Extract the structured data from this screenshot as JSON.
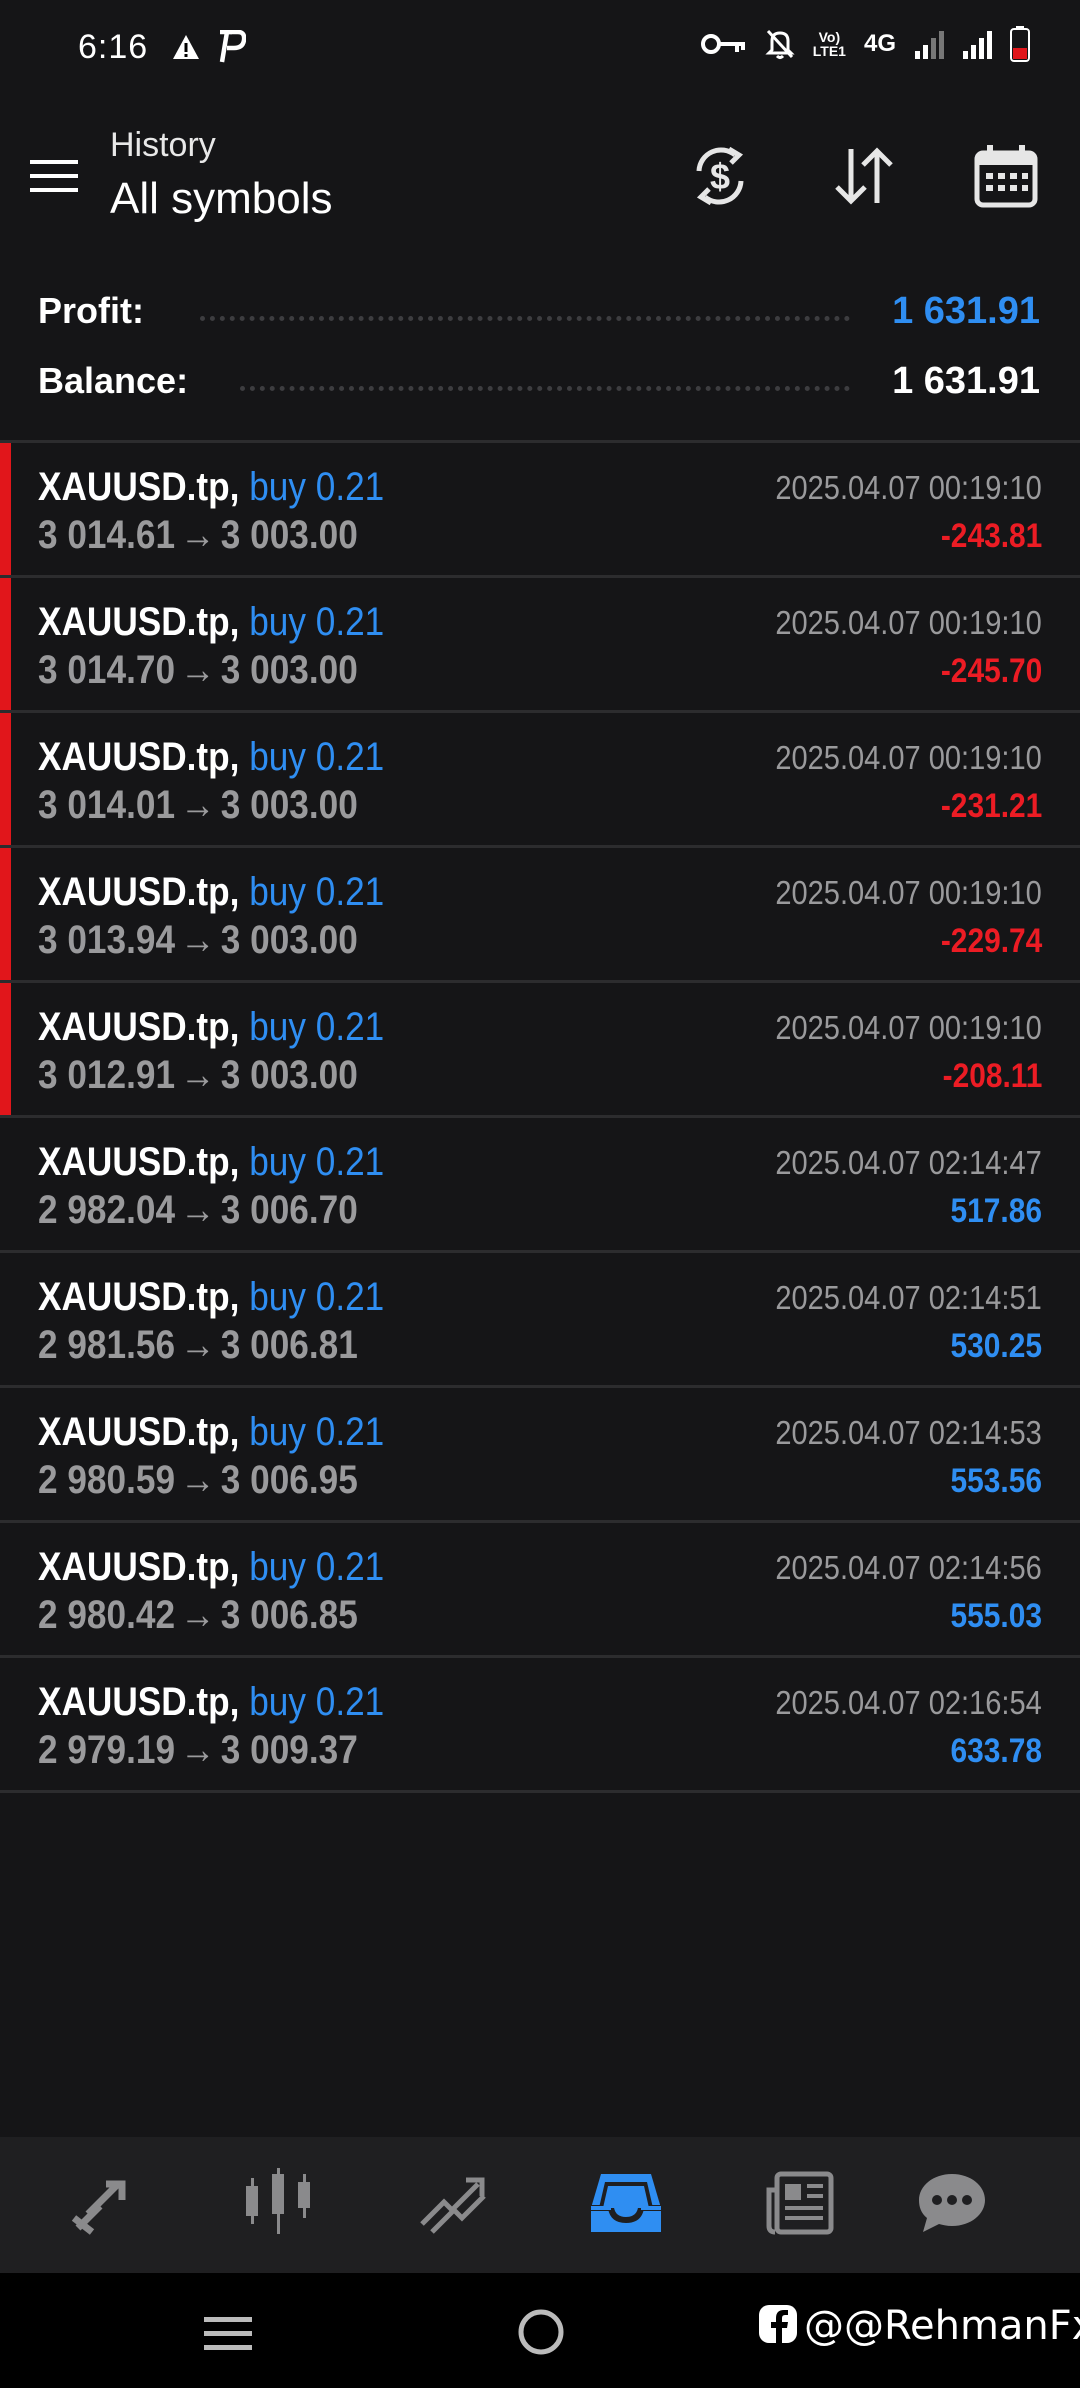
{
  "status_bar": {
    "time": "6:16",
    "network": "4G",
    "volte": "Vo\nLTE1",
    "icons": [
      "warning-icon",
      "p-app-icon",
      "vpn-key-icon",
      "mute-bell-icon",
      "volte-icon",
      "signal-icon",
      "signal-icon",
      "battery-low-icon"
    ]
  },
  "header": {
    "subtitle": "History",
    "title": "All symbols",
    "actions": [
      "currency-exchange-icon",
      "sort-icon",
      "calendar-icon"
    ]
  },
  "summary": {
    "profit_label": "Profit:",
    "profit_value": "1 631.91",
    "balance_label": "Balance:",
    "balance_value": "1 631.91"
  },
  "trades": [
    {
      "symbol": "XAUUSD.tp",
      "type": "buy 0.21",
      "open": "3 014.61",
      "close": "3 003.00",
      "time": "2025.04.07 00:19:10",
      "profit": "-243.81",
      "loss": true
    },
    {
      "symbol": "XAUUSD.tp",
      "type": "buy 0.21",
      "open": "3 014.70",
      "close": "3 003.00",
      "time": "2025.04.07 00:19:10",
      "profit": "-245.70",
      "loss": true
    },
    {
      "symbol": "XAUUSD.tp",
      "type": "buy 0.21",
      "open": "3 014.01",
      "close": "3 003.00",
      "time": "2025.04.07 00:19:10",
      "profit": "-231.21",
      "loss": true
    },
    {
      "symbol": "XAUUSD.tp",
      "type": "buy 0.21",
      "open": "3 013.94",
      "close": "3 003.00",
      "time": "2025.04.07 00:19:10",
      "profit": "-229.74",
      "loss": true
    },
    {
      "symbol": "XAUUSD.tp",
      "type": "buy 0.21",
      "open": "3 012.91",
      "close": "3 003.00",
      "time": "2025.04.07 00:19:10",
      "profit": "-208.11",
      "loss": true
    },
    {
      "symbol": "XAUUSD.tp",
      "type": "buy 0.21",
      "open": "2 982.04",
      "close": "3 006.70",
      "time": "2025.04.07 02:14:47",
      "profit": "517.86",
      "loss": false
    },
    {
      "symbol": "XAUUSD.tp",
      "type": "buy 0.21",
      "open": "2 981.56",
      "close": "3 006.81",
      "time": "2025.04.07 02:14:51",
      "profit": "530.25",
      "loss": false
    },
    {
      "symbol": "XAUUSD.tp",
      "type": "buy 0.21",
      "open": "2 980.59",
      "close": "3 006.95",
      "time": "2025.04.07 02:14:53",
      "profit": "553.56",
      "loss": false
    },
    {
      "symbol": "XAUUSD.tp",
      "type": "buy 0.21",
      "open": "2 980.42",
      "close": "3 006.85",
      "time": "2025.04.07 02:14:56",
      "profit": "555.03",
      "loss": false
    },
    {
      "symbol": "XAUUSD.tp",
      "type": "buy 0.21",
      "open": "2 979.19",
      "close": "3 009.37",
      "time": "2025.04.07 02:16:54",
      "profit": "633.78",
      "loss": false
    }
  ],
  "bottom_nav": {
    "items": [
      "quotes-icon",
      "chart-icon",
      "trade-icon",
      "history-icon",
      "news-icon",
      "chat-icon"
    ],
    "active": "history-icon"
  },
  "watermark": {
    "text": "@@RehmanFx",
    "icon": "facebook-icon"
  },
  "colors": {
    "background": "#151517",
    "accent": "#2f8ef2",
    "loss": "#ec1c24",
    "muted": "#9a9a9c"
  }
}
